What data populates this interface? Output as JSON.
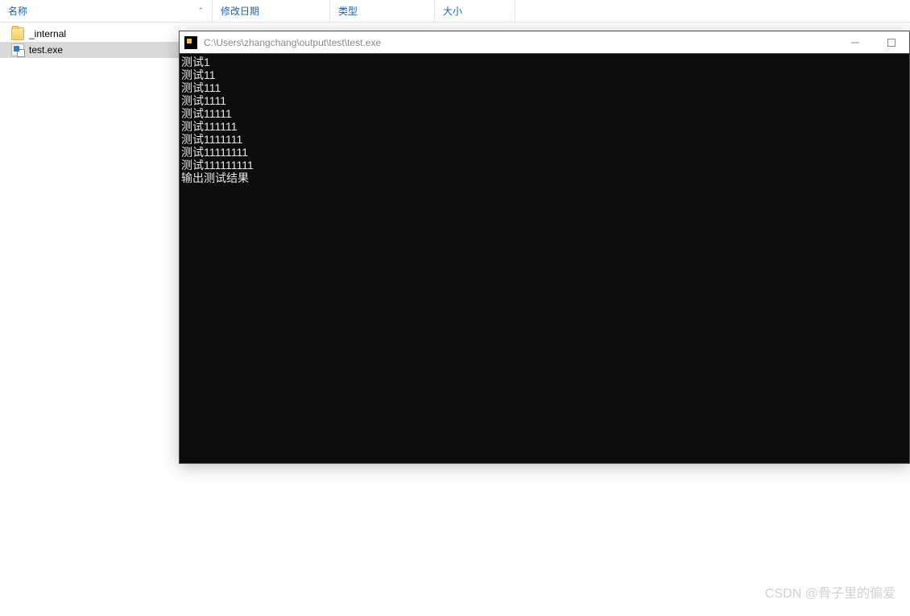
{
  "explorer": {
    "columns": {
      "name": "名称",
      "date": "修改日期",
      "type": "类型",
      "size": "大小"
    },
    "items": [
      {
        "name": "_internal",
        "kind": "folder",
        "selected": false
      },
      {
        "name": "test.exe",
        "kind": "exe",
        "selected": true
      }
    ]
  },
  "console": {
    "title": "C:\\Users\\zhangchang\\output\\test\\test.exe",
    "lines": [
      "测试1",
      "测试11",
      "测试111",
      "测试1111",
      "测试11111",
      "测试111111",
      "测试1111111",
      "测试11111111",
      "测试111111111",
      "输出测试结果"
    ]
  },
  "watermark": "CSDN @骨子里的偏爱"
}
